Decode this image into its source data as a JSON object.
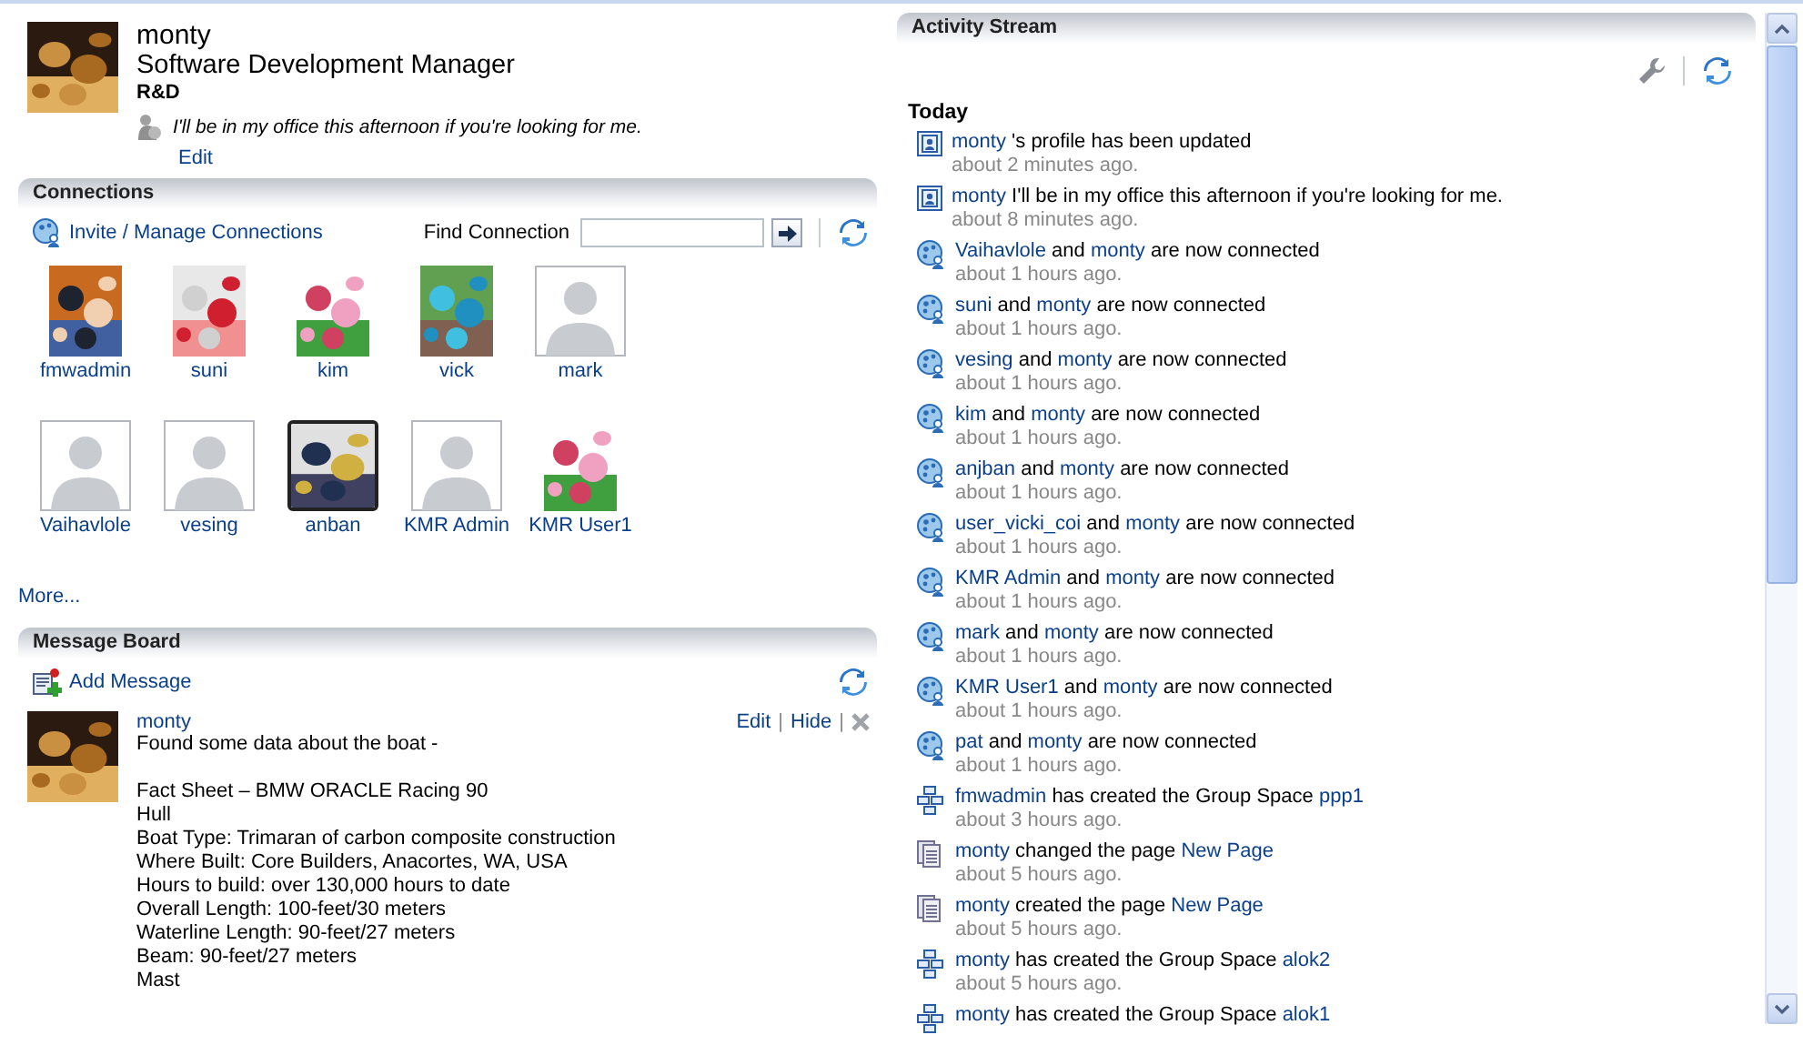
{
  "profile": {
    "name": "monty",
    "title": "Software Development Manager",
    "department": "R&D",
    "status": "I'll be in my office this afternoon if you're looking for me.",
    "edit_link": "Edit"
  },
  "connections": {
    "title": "Connections",
    "invite_link": "Invite / Manage Connections",
    "find_label": "Find Connection",
    "people": [
      {
        "name": "fmwadmin"
      },
      {
        "name": "suni"
      },
      {
        "name": "kim"
      },
      {
        "name": "vick"
      },
      {
        "name": "mark",
        "kind": "silhouette"
      },
      {
        "name": "Vaihavlole",
        "kind": "silhouette"
      },
      {
        "name": "vesing",
        "kind": "silhouette"
      },
      {
        "name": "anban",
        "kind": "framed"
      },
      {
        "name": "KMR Admin",
        "kind": "silhouette"
      },
      {
        "name": "KMR User1"
      }
    ],
    "more_link": "More..."
  },
  "message_board": {
    "title": "Message Board",
    "add_link": "Add Message",
    "messages": [
      {
        "author": "monty",
        "actions": [
          "Edit",
          "Hide"
        ],
        "separator": "|",
        "paragraphs": [
          [
            "Found some data about the boat -"
          ],
          [
            "Fact Sheet – BMW ORACLE Racing 90",
            "Hull",
            "Boat Type: Trimaran of carbon composite construction",
            "Where Built: Core Builders, Anacortes, WA, USA",
            "Hours to build: over 130,000 hours to date",
            "Overall Length: 100-feet/30 meters",
            "Waterline Length: 90-feet/27 meters",
            "Beam: 90-feet/27 meters",
            "Mast"
          ]
        ]
      }
    ]
  },
  "activity_stream": {
    "title": "Activity Stream",
    "group": "Today",
    "items": [
      {
        "kind": "profile",
        "parts": [
          {
            "text": "monty",
            "link": true
          },
          {
            "text": "'s profile has been updated",
            "link": false
          }
        ],
        "time": "about 2 minutes ago."
      },
      {
        "kind": "profile",
        "parts": [
          {
            "text": "monty",
            "link": true
          },
          {
            "text": "I'll be in my office this afternoon if you're looking for me.",
            "link": false
          }
        ],
        "time": "about 8 minutes ago."
      },
      {
        "kind": "connection",
        "parts": [
          {
            "text": "Vaihavlole",
            "link": true
          },
          {
            "text": "and",
            "link": false
          },
          {
            "text": "monty",
            "link": true
          },
          {
            "text": "are now connected",
            "link": false
          }
        ],
        "time": "about 1 hours ago."
      },
      {
        "kind": "connection",
        "parts": [
          {
            "text": "suni",
            "link": true
          },
          {
            "text": "and",
            "link": false
          },
          {
            "text": "monty",
            "link": true
          },
          {
            "text": "are now connected",
            "link": false
          }
        ],
        "time": "about 1 hours ago."
      },
      {
        "kind": "connection",
        "parts": [
          {
            "text": "vesing",
            "link": true
          },
          {
            "text": "and",
            "link": false
          },
          {
            "text": "monty",
            "link": true
          },
          {
            "text": "are now connected",
            "link": false
          }
        ],
        "time": "about 1 hours ago."
      },
      {
        "kind": "connection",
        "parts": [
          {
            "text": "kim",
            "link": true
          },
          {
            "text": "and",
            "link": false
          },
          {
            "text": "monty",
            "link": true
          },
          {
            "text": "are now connected",
            "link": false
          }
        ],
        "time": "about 1 hours ago."
      },
      {
        "kind": "connection",
        "parts": [
          {
            "text": "anjban",
            "link": true
          },
          {
            "text": "and",
            "link": false
          },
          {
            "text": "monty",
            "link": true
          },
          {
            "text": "are now connected",
            "link": false
          }
        ],
        "time": "about 1 hours ago."
      },
      {
        "kind": "connection",
        "parts": [
          {
            "text": "user_vicki_coi",
            "link": true
          },
          {
            "text": "and",
            "link": false
          },
          {
            "text": "monty",
            "link": true
          },
          {
            "text": "are now connected",
            "link": false
          }
        ],
        "time": "about 1 hours ago."
      },
      {
        "kind": "connection",
        "parts": [
          {
            "text": "KMR Admin",
            "link": true
          },
          {
            "text": "and",
            "link": false
          },
          {
            "text": "monty",
            "link": true
          },
          {
            "text": "are now connected",
            "link": false
          }
        ],
        "time": "about 1 hours ago."
      },
      {
        "kind": "connection",
        "parts": [
          {
            "text": "mark",
            "link": true
          },
          {
            "text": "and",
            "link": false
          },
          {
            "text": "monty",
            "link": true
          },
          {
            "text": "are now connected",
            "link": false
          }
        ],
        "time": "about 1 hours ago."
      },
      {
        "kind": "connection",
        "parts": [
          {
            "text": "KMR User1",
            "link": true
          },
          {
            "text": "and",
            "link": false
          },
          {
            "text": "monty",
            "link": true
          },
          {
            "text": "are now connected",
            "link": false
          }
        ],
        "time": "about 1 hours ago."
      },
      {
        "kind": "connection",
        "parts": [
          {
            "text": "pat",
            "link": true
          },
          {
            "text": "and",
            "link": false
          },
          {
            "text": "monty",
            "link": true
          },
          {
            "text": "are now connected",
            "link": false
          }
        ],
        "time": "about 1 hours ago."
      },
      {
        "kind": "groupspace",
        "parts": [
          {
            "text": "fmwadmin",
            "link": true
          },
          {
            "text": "has created the Group Space",
            "link": false
          },
          {
            "text": "ppp1",
            "link": true
          }
        ],
        "time": "about 3 hours ago."
      },
      {
        "kind": "page",
        "parts": [
          {
            "text": "monty",
            "link": true
          },
          {
            "text": "changed the page",
            "link": false
          },
          {
            "text": "New Page",
            "link": true
          }
        ],
        "time": "about 5 hours ago."
      },
      {
        "kind": "page",
        "parts": [
          {
            "text": "monty",
            "link": true
          },
          {
            "text": "created the page",
            "link": false
          },
          {
            "text": "New Page",
            "link": true
          }
        ],
        "time": "about 5 hours ago."
      },
      {
        "kind": "groupspace",
        "parts": [
          {
            "text": "monty",
            "link": true
          },
          {
            "text": "has created the Group Space",
            "link": false
          },
          {
            "text": "alok2",
            "link": true
          }
        ],
        "time": "about 5 hours ago."
      },
      {
        "kind": "groupspace",
        "parts": [
          {
            "text": "monty",
            "link": true
          },
          {
            "text": "has created the Group Space",
            "link": false
          },
          {
            "text": "alok1",
            "link": true
          }
        ]
      }
    ]
  }
}
